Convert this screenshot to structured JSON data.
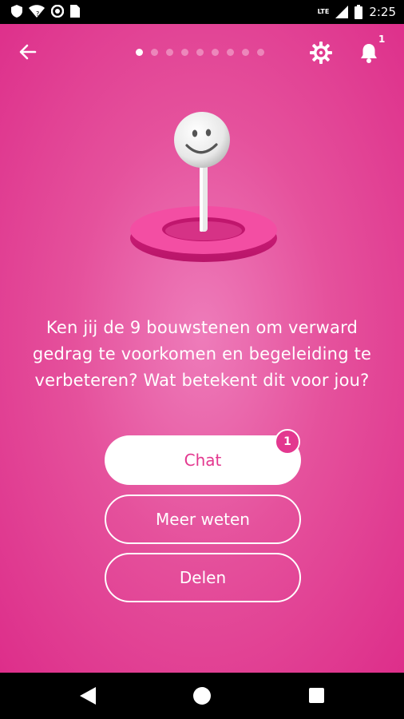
{
  "status_bar": {
    "time": "2:25",
    "network": "LTE",
    "icons": [
      "shield-icon",
      "wifi-icon",
      "circle-icon",
      "sim-icon",
      "signal-icon",
      "battery-icon"
    ]
  },
  "header": {
    "back_icon": "arrow-left-icon",
    "pages_total": 9,
    "page_current": 1,
    "settings_icon": "gear-icon",
    "notification_icon": "bell-icon",
    "notification_count": "1"
  },
  "illustration": {
    "subject": "smiley-pin-in-ring"
  },
  "main": {
    "question": "Ken jij de 9 bouwstenen om verward gedrag te voorkomen en begeleiding te verbeteren? Wat betekent dit voor jou?"
  },
  "actions": {
    "chat_label": "Chat",
    "chat_badge": "1",
    "more_label": "Meer weten",
    "share_label": "Delen"
  },
  "colors": {
    "background": "#e0368e",
    "accent": "#e3388f"
  },
  "nav_bar": {
    "icons": [
      "back-triangle-icon",
      "home-circle-icon",
      "recents-square-icon"
    ]
  }
}
